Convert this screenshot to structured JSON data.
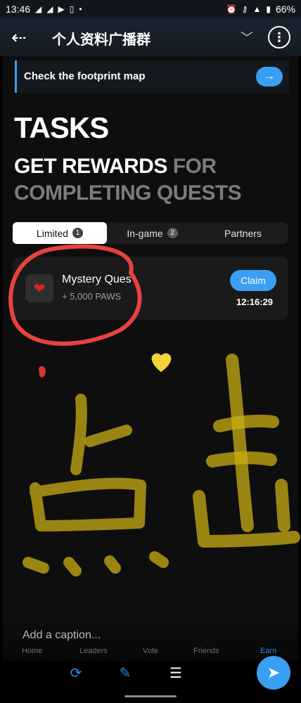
{
  "status_bar": {
    "time": "13:46",
    "battery": "66%",
    "left_icons": [
      "telegram-icon",
      "telegram-icon",
      "youtube-icon",
      "clipboard-icon"
    ],
    "right_icons": [
      "alarm-icon",
      "key-icon",
      "wifi-icon",
      "battery-icon"
    ]
  },
  "header": {
    "title": "个人资料广播群"
  },
  "app": {
    "footprint_banner": "Check the footprint map",
    "title": "TASKS",
    "subtitle_highlight": "GET REWARDS",
    "subtitle_rest": "FOR COMPLETING QUESTS",
    "tabs": [
      {
        "label": "Limited",
        "badge": "1",
        "active": true
      },
      {
        "label": "In-game",
        "badge": "2",
        "active": false
      },
      {
        "label": "Partners",
        "badge": "",
        "active": false
      }
    ],
    "quest": {
      "name": "Mystery Ques",
      "reward": "+ 5,000 PAWS",
      "claim_label": "Claim",
      "timer": "12:16:29"
    },
    "nav": [
      "Home",
      "Leaders",
      "Vote",
      "Friends",
      "Earn"
    ]
  },
  "editor": {
    "caption_placeholder": "Add a caption...",
    "tools": [
      "crop-rotate-icon",
      "brush-icon",
      "adjust-sliders-icon"
    ],
    "drawing_colors": {
      "circle": "#e8423f",
      "scribble": "#d8c11a"
    }
  },
  "colors": {
    "accent": "#3a9ff2",
    "background": "#0e0e0e"
  }
}
